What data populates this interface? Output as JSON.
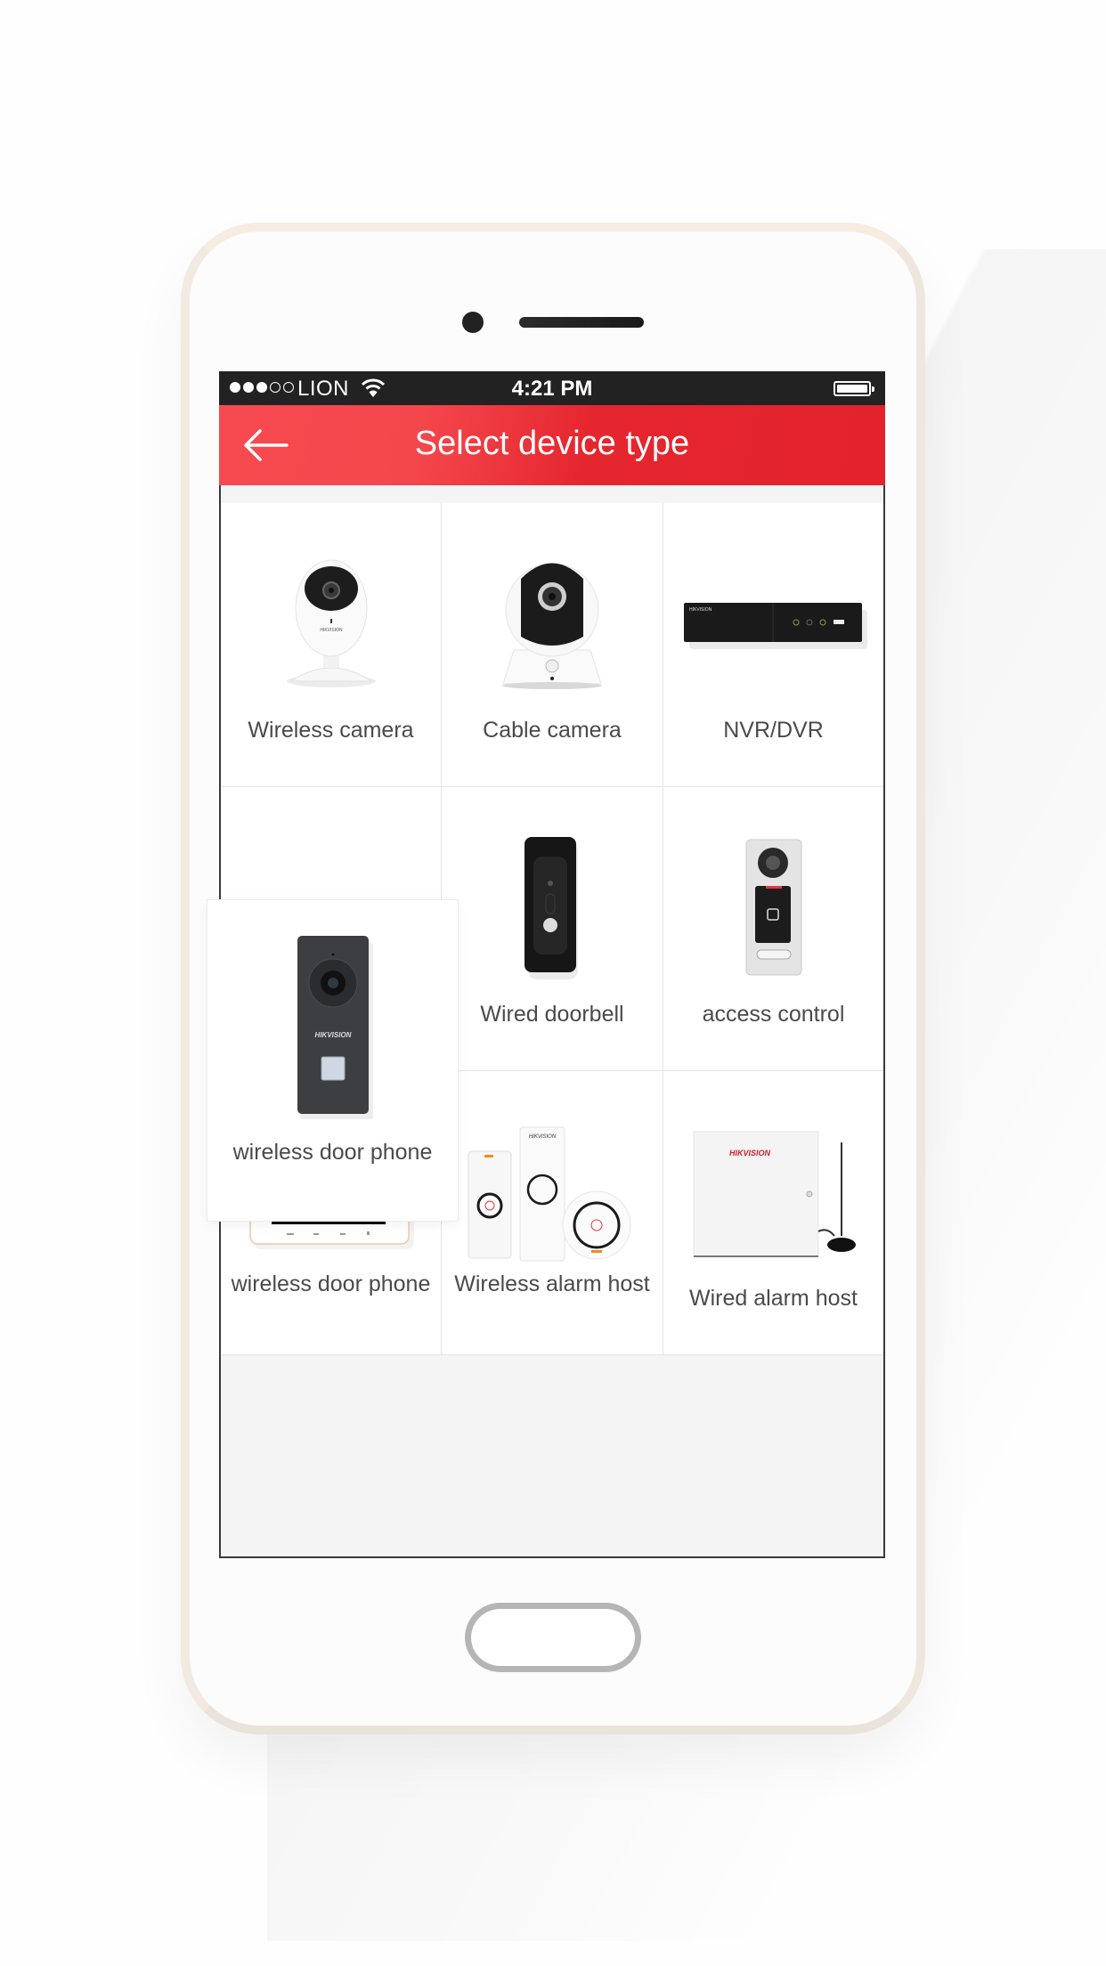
{
  "status_bar": {
    "signal_bars_filled": 3,
    "signal_bars_total": 5,
    "carrier": "LION",
    "wifi_icon": "wifi-icon",
    "time": "4:21 PM",
    "battery_level": "full"
  },
  "header": {
    "back_icon": "arrow-left-icon",
    "title": "Select device type"
  },
  "colors": {
    "header_red_start": "#f64a50",
    "header_red_end": "#e3222c",
    "status_bar_bg": "#222222",
    "label_text": "#4a4a4a",
    "screen_bg": "#f4f4f4"
  },
  "devices": [
    {
      "label": "Wireless camera",
      "icon": "wireless-camera-image"
    },
    {
      "label": "Cable camera",
      "icon": "cable-camera-image"
    },
    {
      "label": "NVR/DVR",
      "icon": "nvr-dvr-image"
    },
    {
      "label": "wireless door phone",
      "icon": "wireless-doorbell-image",
      "highlighted": true
    },
    {
      "label": "Wired doorbell",
      "icon": "wired-doorbell-image"
    },
    {
      "label": "access control",
      "icon": "access-control-image"
    },
    {
      "label": "wireless door phone",
      "icon": "indoor-monitor-image"
    },
    {
      "label": "Wireless alarm host",
      "icon": "wireless-alarm-host-image"
    },
    {
      "label": "Wired alarm host",
      "icon": "wired-alarm-host-image"
    }
  ],
  "brand_text": "HIKVISION"
}
